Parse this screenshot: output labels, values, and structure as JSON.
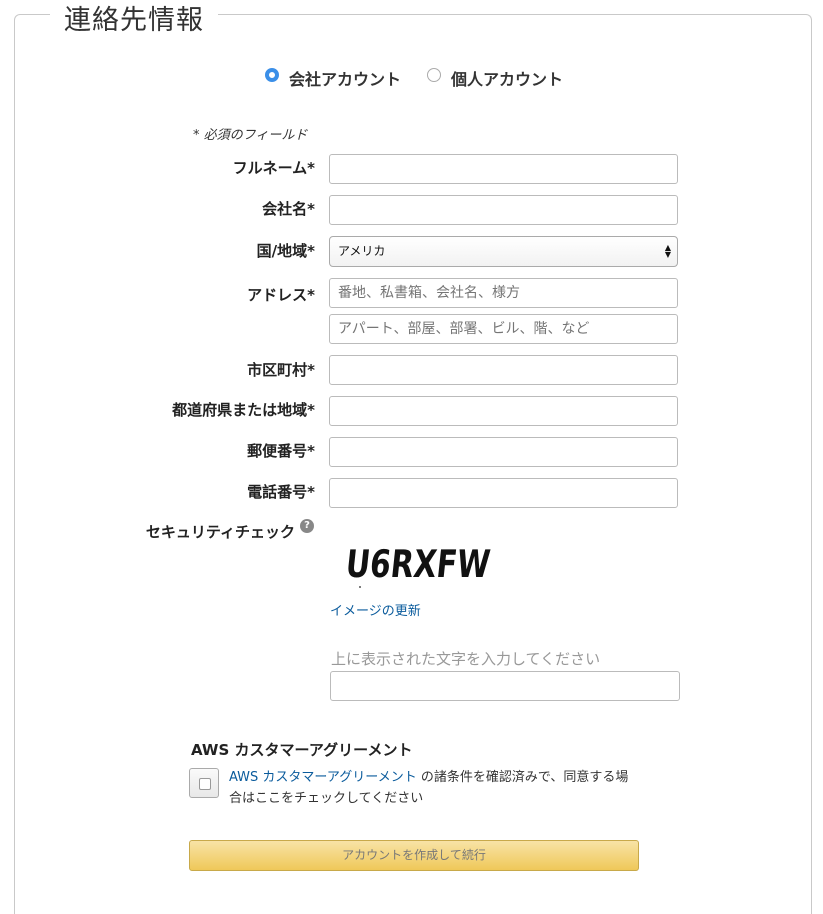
{
  "section_title": "連絡先情報",
  "account_type": {
    "options": [
      {
        "label": "会社アカウント",
        "selected": true
      },
      {
        "label": "個人アカウント",
        "selected": false
      }
    ]
  },
  "required_note": "* 必須のフィールド",
  "fields": {
    "full_name": {
      "label": "フルネーム*",
      "value": ""
    },
    "company": {
      "label": "会社名*",
      "value": ""
    },
    "country": {
      "label": "国/地域*",
      "selected": "アメリカ"
    },
    "address": {
      "label": "アドレス*",
      "line1_placeholder": "番地、私書箱、会社名、様方",
      "line2_placeholder": "アパート、部屋、部署、ビル、階、など"
    },
    "city": {
      "label": "市区町村*",
      "value": ""
    },
    "state": {
      "label": "都道府県または地域*",
      "value": ""
    },
    "postal": {
      "label": "郵便番号*",
      "value": ""
    },
    "phone": {
      "label": "電話番号*",
      "value": ""
    }
  },
  "security": {
    "label": "セキュリティチェック",
    "help_symbol": "?",
    "captcha_text": "U6RXFW",
    "refresh_link": "イメージの更新",
    "hint": "上に表示された文字を入力してください",
    "value": ""
  },
  "agreement": {
    "title": "AWS カスタマーアグリーメント",
    "link_text": "AWS カスタマーアグリーメント",
    "text": " の諸条件を確認済みで、同意する場合はここをチェックしてください",
    "checked": false
  },
  "submit_label": "アカウントを作成して続行",
  "colors": {
    "link": "#0a5b9c",
    "radio_accent": "#3b8fe8",
    "button": "#efc859"
  }
}
